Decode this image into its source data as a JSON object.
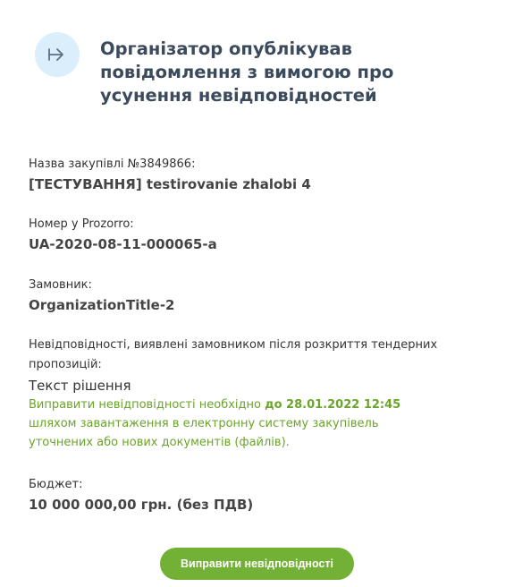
{
  "header": {
    "icon": "arrow-right-to-bar-icon",
    "title": "Організатор опублікував повідомлення з вимогою про усунення невідповідностей"
  },
  "procurement": {
    "label": "Назва закупівлі №3849866:",
    "value": "[ТЕСТУВАННЯ] testirovanie zhalobi 4"
  },
  "prozorro": {
    "label": "Номер у Prozorro:",
    "value": "UA-2020-08-11-000065-a"
  },
  "customer": {
    "label": "Замовник:",
    "value": "OrganizationTitle-2"
  },
  "discrepancies": {
    "label": "Невідповідності, виявлені замовником після розкриття тендерних пропозицій:",
    "value": "Текст рішення",
    "notice_before": "Виправити невідповідності необхідно ",
    "deadline": "до 28.01.2022 12:45",
    "notice_after": " шляхом завантаження в електронну систему закупівель уточнених або нових документів (файлів)."
  },
  "budget": {
    "label": "Бюджет:",
    "value": "10 000 000,00 грн. (без ПДВ)"
  },
  "action_button": {
    "label": "Виправити невідповідності"
  },
  "colors": {
    "accent_green": "#73b136",
    "notice_green": "#6aa42a",
    "icon_bg": "#dbeefb",
    "title": "#3b4a5c"
  }
}
